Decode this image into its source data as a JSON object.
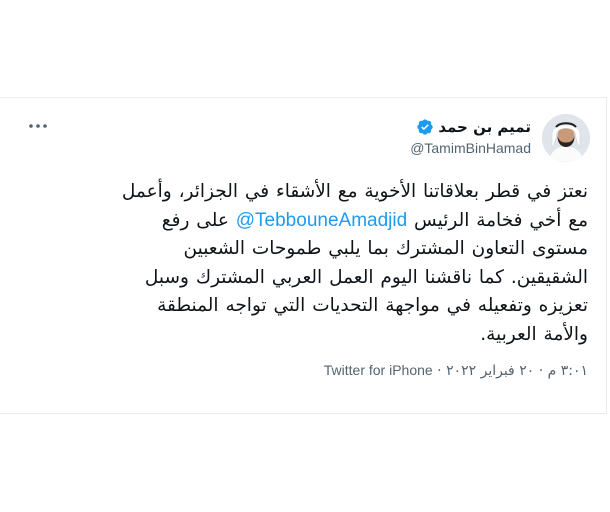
{
  "tweet": {
    "author": {
      "display_name": "تميم بن حمد",
      "handle": "@TamimBinHamad",
      "verified_icon": "verified-badge-icon",
      "avatar_icon": "profile-photo"
    },
    "more_icon": "more-options-icon",
    "body": {
      "line1": "نعتز في قطر بعلاقاتنا الأخوية مع الأشقاء في الجزائر، وأعمل",
      "line2_before": "مع أخي فخامة الرئيس ",
      "line2_mention": "@TebbouneAmadjid",
      "line2_after": " على رفع",
      "line3": "مستوى التعاون المشترك بما يلبي طموحات الشعبين",
      "line4": "الشقيقين. كما ناقشنا اليوم العمل العربي المشترك وسبل",
      "line5": "تعزيزه وتفعيله في مواجهة التحديات التي تواجه المنطقة",
      "line6": "والأمة العربية."
    },
    "meta": {
      "time_date": "٣:٠١ م · ٢٠ فبراير ٢٠٢٢ · ",
      "client": "Twitter for iPhone"
    },
    "colors": {
      "link": "#1d9bf0",
      "text": "#0f1419",
      "secondary": "#536471"
    }
  }
}
